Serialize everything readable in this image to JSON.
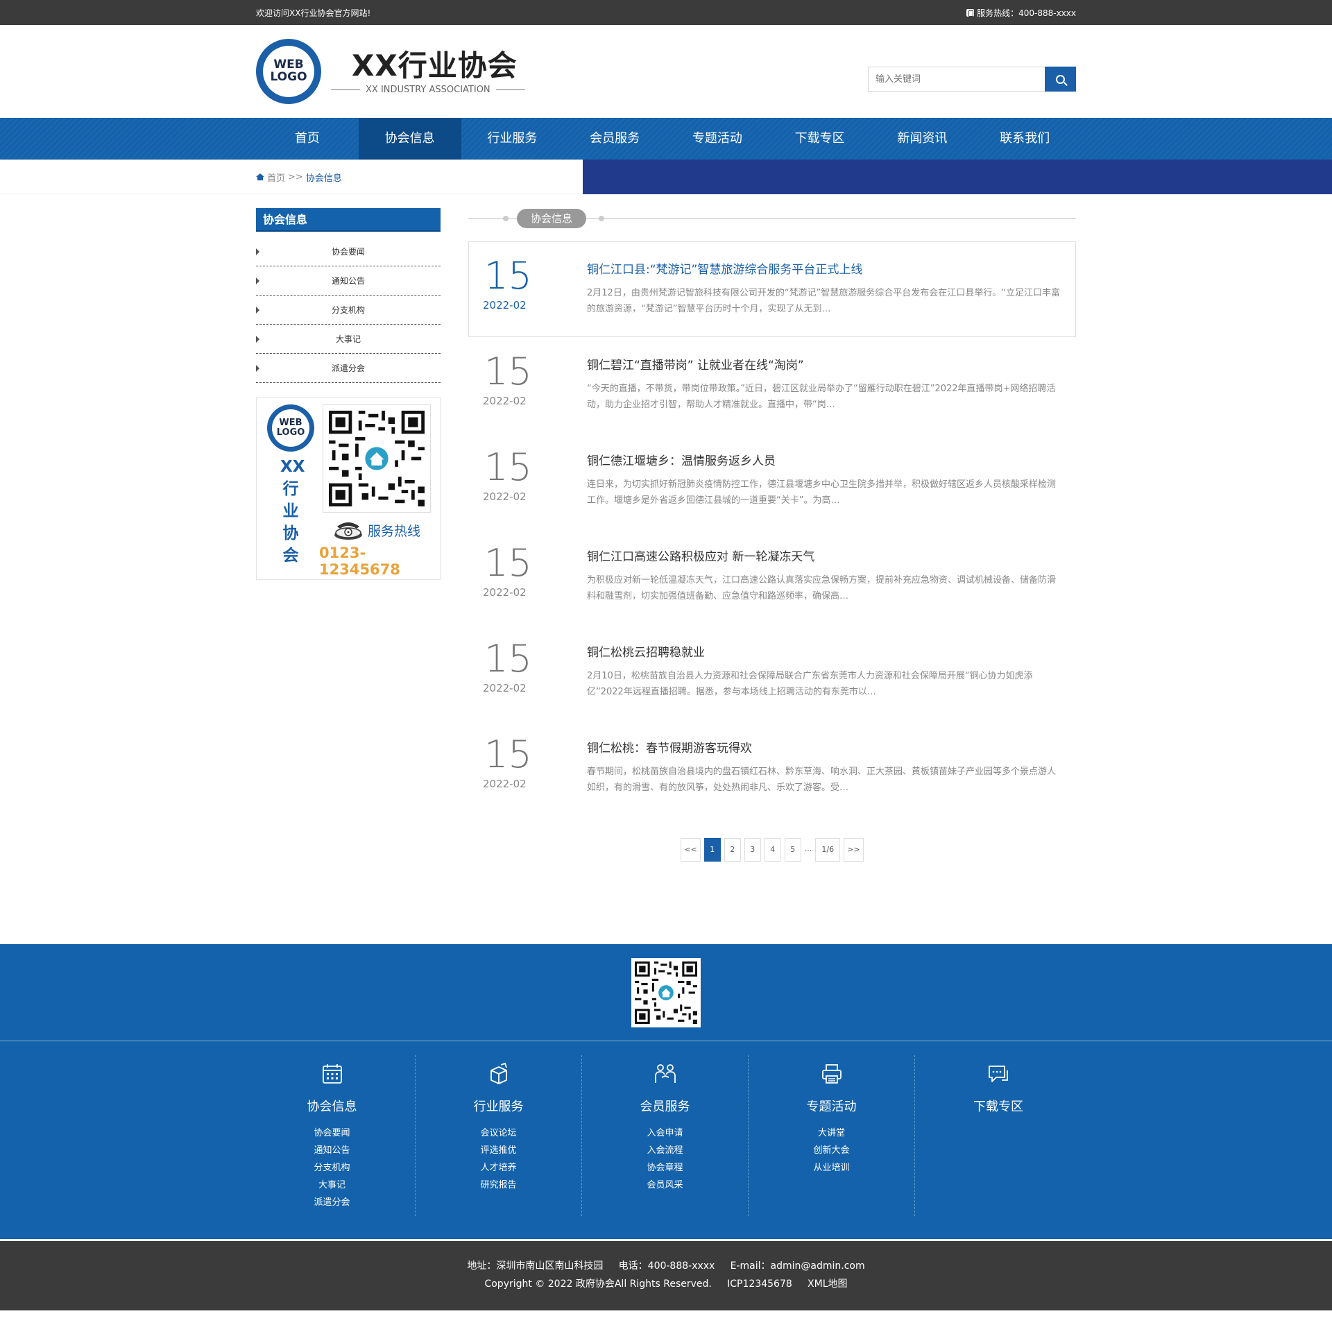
{
  "topbar": {
    "welcome": "欢迎访问XX行业协会官方网站!",
    "hotline": "服务热线：400-888-xxxx"
  },
  "header": {
    "logo_line1": "WEB",
    "logo_line2": "LOGO",
    "name": "XX行业协会",
    "name_en": "XX INDUSTRY ASSOCIATION",
    "search_placeholder": "输入关键词"
  },
  "nav": {
    "items": [
      {
        "label": "首页"
      },
      {
        "label": "协会信息",
        "active": true
      },
      {
        "label": "行业服务"
      },
      {
        "label": "会员服务"
      },
      {
        "label": "专题活动"
      },
      {
        "label": "下载专区"
      },
      {
        "label": "新闻资讯"
      },
      {
        "label": "联系我们"
      }
    ]
  },
  "breadcrumb": {
    "home": "首页",
    "sep": ">>",
    "current": "协会信息"
  },
  "sidebar": {
    "title": "协会信息",
    "items": [
      {
        "label": "协会要闻"
      },
      {
        "label": "通知公告"
      },
      {
        "label": "分支机构"
      },
      {
        "label": "大事记"
      },
      {
        "label": "派遣分会"
      }
    ],
    "card": {
      "logo_line1": "WEB",
      "logo_line2": "LOGO",
      "vertical_name": [
        "XX",
        "行",
        "业",
        "协",
        "会"
      ],
      "hotline_label": "服务热线",
      "hotline_number": "0123-12345678"
    }
  },
  "content": {
    "section_title": "协会信息",
    "news": [
      {
        "day": "15",
        "ym": "2022-02",
        "title": "铜仁江口县:“梵游记”智慧旅游综合服务平台正式上线",
        "desc": "2月12日，由贵州梵游记智旅科技有限公司开发的“梵游记”智慧旅游服务综合平台发布会在江口县举行。“立足江口丰富的旅游资源，“梵游记”智慧平台历时十个月，实现了从无到…"
      },
      {
        "day": "15",
        "ym": "2022-02",
        "title": "铜仁碧江“直播带岗” 让就业者在线“淘岗”",
        "desc": "“今天的直播，不带货，带岗位带政策。”近日，碧江区就业局举办了“留雁行动职在碧江”2022年直播带岗+网络招聘活动，助力企业招才引智，帮助人才精准就业。直播中，带“岗…"
      },
      {
        "day": "15",
        "ym": "2022-02",
        "title": "铜仁德江堰塘乡：温情服务返乡人员",
        "desc": "连日来，为切实抓好新冠肺炎疫情防控工作，德江县堰塘乡中心卫生院多措并举，积极做好辖区返乡人员核酸采样检测工作。堰塘乡是外省返乡回德江县城的一道重要“关卡”。为高…"
      },
      {
        "day": "15",
        "ym": "2022-02",
        "title": "铜仁江口高速公路积极应对 新一轮凝冻天气",
        "desc": "为积极应对新一轮低温凝冻天气，江口高速公路认真落实应急保畅方案，提前补充应急物资、调试机械设备、储备防滑料和融雪剂，切实加强值班备勤、应急值守和路巡频率，确保高…"
      },
      {
        "day": "15",
        "ym": "2022-02",
        "title": "铜仁松桃云招聘稳就业",
        "desc": "2月10日，松桃苗族自治县人力资源和社会保障局联合广东省东莞市人力资源和社会保障局开展“铜心协力如虎添亿”2022年远程直播招聘。据悉，参与本场线上招聘活动的有东莞市以…"
      },
      {
        "day": "15",
        "ym": "2022-02",
        "title": "铜仁松桃：春节假期游客玩得欢",
        "desc": "春节期间，松桃苗族自治县境内的盘石镇红石林、黔东草海、响水洞、正大茶园、黄板镇苗妹子产业园等多个景点游人如织，有的滑雪、有的放风筝，处处热闹非凡、乐欢了游客。受…"
      }
    ],
    "pager": {
      "prev": "<<",
      "pages": [
        "1",
        "2",
        "3",
        "4",
        "5"
      ],
      "current": "1",
      "dots": "...",
      "total": "1/6",
      "next": ">>"
    }
  },
  "footer": {
    "columns": [
      {
        "icon": "calendar-icon",
        "title": "协会信息",
        "links": [
          "协会要闻",
          "通知公告",
          "分支机构",
          "大事记",
          "派遣分会"
        ]
      },
      {
        "icon": "box-icon",
        "title": "行业服务",
        "links": [
          "会议论坛",
          "评选推优",
          "人才培养",
          "研究报告"
        ]
      },
      {
        "icon": "people-icon",
        "title": "会员服务",
        "links": [
          "入会申请",
          "入会流程",
          "协会章程",
          "会员风采"
        ]
      },
      {
        "icon": "printer-icon",
        "title": "专题活动",
        "links": [
          "大讲堂",
          "创新大会",
          "从业培训"
        ]
      },
      {
        "icon": "chat-icon",
        "title": "下载专区",
        "links": []
      }
    ],
    "address": "地址：深圳市南山区南山科技园",
    "phone": "电话：400-888-xxxx",
    "email": "E-mail：admin@admin.com",
    "copyright": "Copyright © 2022 政府协会All Rights Reserved.",
    "icp": "ICP12345678",
    "sitemap": "XML地图"
  },
  "colors": {
    "primary": "#1462ab",
    "nav_active": "#0c4a88",
    "band": "#213a8b",
    "dark": "#3b3b3b",
    "accent_orange": "#e8a33b"
  }
}
